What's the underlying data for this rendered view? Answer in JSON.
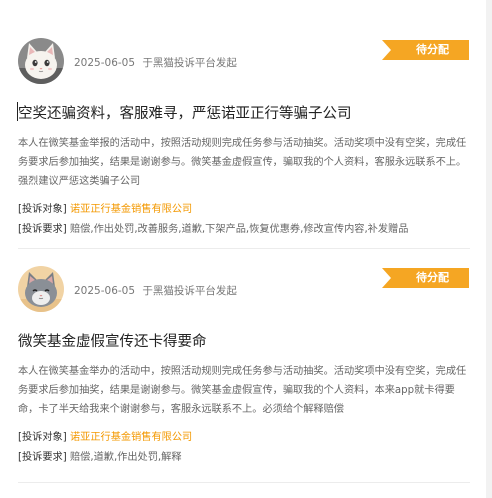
{
  "posts": [
    {
      "avatar": "white-cat-avatar",
      "date": "2025-06-05",
      "platform_text": "于黑猫投诉平台发起",
      "status": "待分配",
      "title": "空奖还骗资料，客服难寻，严惩诺亚正行等骗子公司",
      "body": "本人在微笑基金举报的活动中，按照活动规则完成任务参与活动抽奖。活动奖项中没有空奖，完成任务要求后参加抽奖，结果是谢谢参与。微笑基金虚假宣传，骗取我的个人资料，客服永远联系不上。强烈建议严惩这类骗子公司",
      "target_label": "[投诉对象]",
      "target_value": "诺亚正行基金销售有限公司",
      "demand_label": "[投诉要求]",
      "demand_value": "赔偿,作出处罚,改善服务,道歉,下架产品,恢复优惠券,修改宣传内容,补发赠品"
    },
    {
      "avatar": "grey-cat-avatar",
      "date": "2025-06-05",
      "platform_text": "于黑猫投诉平台发起",
      "status": "待分配",
      "title": "微笑基金虚假宣传还卡得要命",
      "body": "本人在微笑基金举办的活动中，按照活动规则完成任务参与活动抽奖。活动奖项中没有空奖，完成任务要求后参加抽奖，结果是谢谢参与。微笑基金虚假宣传，骗取我的个人资料，本来app就卡得要命，卡了半天给我来个谢谢参与，客服永远联系不上。必须给个解释赔偿",
      "target_label": "[投诉对象]",
      "target_value": "诺亚正行基金销售有限公司",
      "demand_label": "[投诉要求]",
      "demand_value": "赔偿,道歉,作出处罚,解释"
    }
  ],
  "colors": {
    "badge": "#f5a623",
    "org_link": "#f39800"
  }
}
